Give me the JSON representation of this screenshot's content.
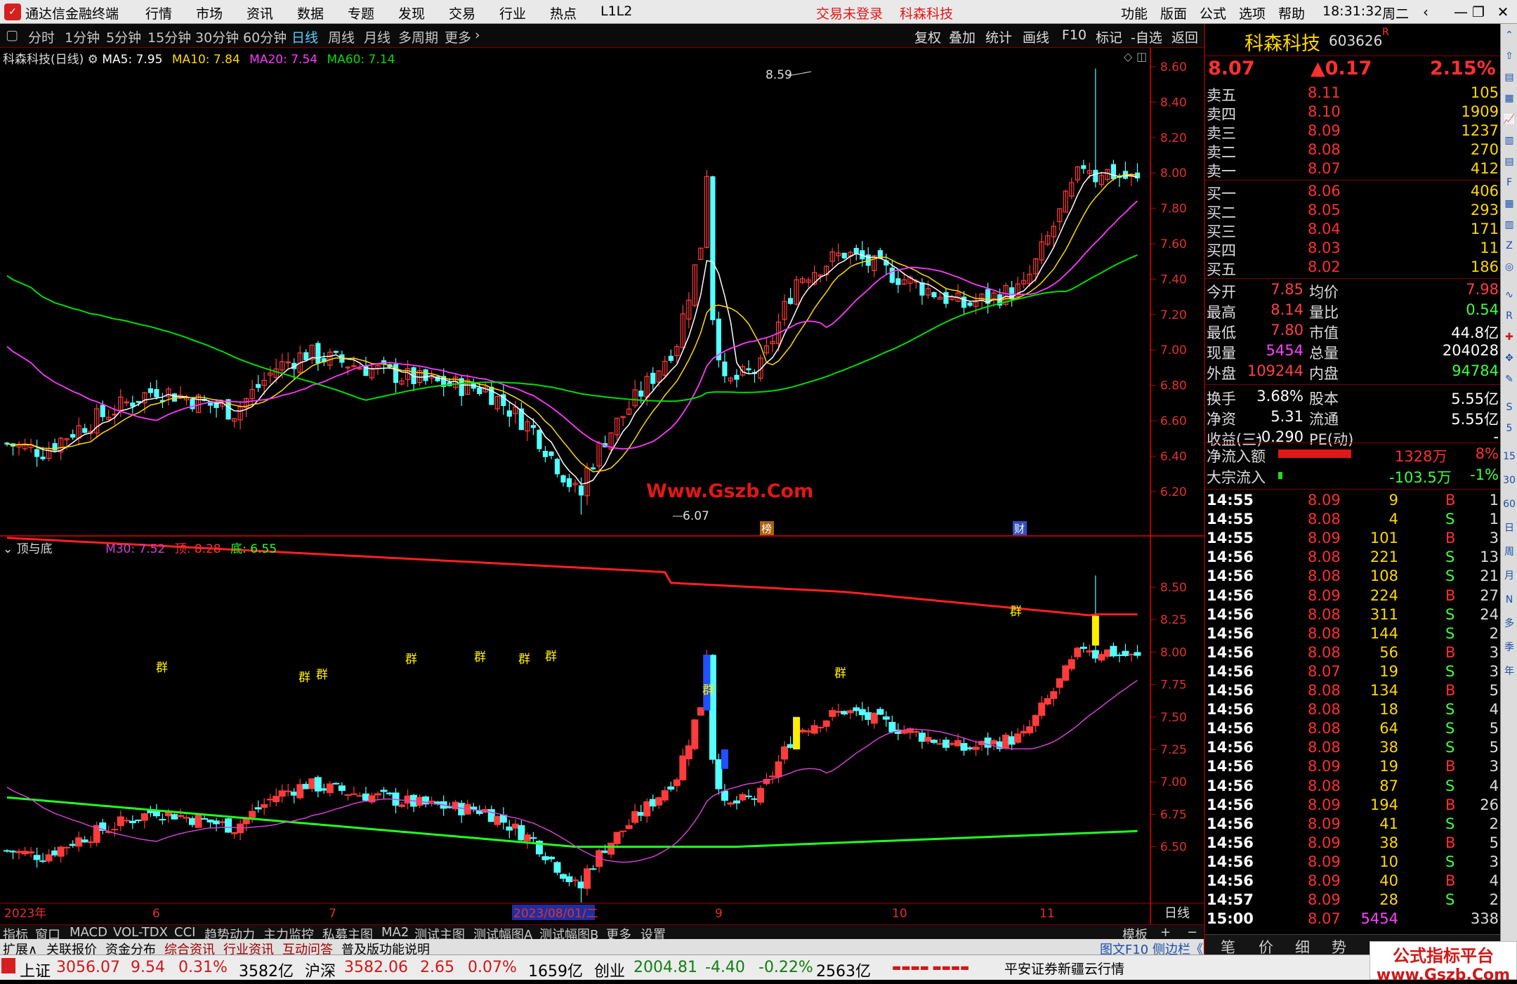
{
  "titlebar": {
    "app_name": "通达信金融终端",
    "menus": [
      "行情",
      "市场",
      "资讯",
      "数据",
      "专题",
      "发现",
      "交易",
      "行业",
      "热点",
      "L1L2"
    ],
    "login_status": "交易未登录",
    "stock_name": "科森科技",
    "right_menus": [
      "功能",
      "版面",
      "公式",
      "选项",
      "帮助"
    ],
    "clock": "18:31:32",
    "weekday": "周二"
  },
  "toolbar": {
    "periods": [
      "分时",
      "1分钟",
      "5分钟",
      "15分钟",
      "30分钟",
      "60分钟",
      "日线",
      "周线",
      "月线",
      "多周期",
      "更多"
    ],
    "active_period": "日线",
    "right_tools": [
      "复权",
      "叠加",
      "统计",
      "画线",
      "F10",
      "标记",
      "-自选",
      "返回"
    ]
  },
  "main_legend": {
    "title": "科森科技(日线)",
    "ma5": "MA5: 7.95",
    "ma10": "MA10: 7.84",
    "ma20": "MA20: 7.54",
    "ma60": "MA60: 7.14"
  },
  "sub_legend": {
    "title": "顶与底",
    "m30": "M30: 7.52",
    "top": "顶: 8.28",
    "bottom": "底: 6.55"
  },
  "annotations": {
    "high_label": "8.59",
    "low_label": "6.07",
    "watermark": "Www.Gszb.Com",
    "badge_bang": "榜",
    "badge_cai": "财",
    "qun_mark": "群"
  },
  "colors": {
    "up": "#ff3b3b",
    "down": "#54ffff",
    "ma5": "#ffffff",
    "ma10": "#ffd800",
    "ma20": "#ff38ff",
    "ma60": "#00dd00",
    "top_line": "#ff2020",
    "bottom_line": "#22ff22",
    "m30": "#d040d0",
    "axis": "#b00000"
  },
  "chart_data": {
    "type": "candlestick",
    "main_y_ticks": [
      "8.60",
      "8.40",
      "8.20",
      "8.00",
      "7.80",
      "7.60",
      "7.40",
      "7.20",
      "7.00",
      "6.80",
      "6.60",
      "6.40",
      "6.20"
    ],
    "sub_y_ticks": [
      "8.50",
      "8.25",
      "8.00",
      "7.75",
      "7.50",
      "7.25",
      "7.00",
      "6.75",
      "6.50"
    ],
    "x_labels": [
      "2023年",
      "6",
      "7",
      "2023/08/01/二",
      "9",
      "10",
      "11"
    ],
    "period_label": "日线",
    "series_names": [
      "MA5",
      "MA10",
      "MA20",
      "MA60",
      "M30",
      "顶",
      "底"
    ]
  },
  "quote": {
    "name": "科森科技",
    "code": "603626",
    "flag": "R",
    "price": "8.07",
    "change": "▲0.17",
    "pct": "2.15%",
    "asks": [
      {
        "label": "卖五",
        "price": "8.11",
        "vol": "105"
      },
      {
        "label": "卖四",
        "price": "8.10",
        "vol": "1909"
      },
      {
        "label": "卖三",
        "price": "8.09",
        "vol": "1237"
      },
      {
        "label": "卖二",
        "price": "8.08",
        "vol": "270"
      },
      {
        "label": "卖一",
        "price": "8.07",
        "vol": "412"
      }
    ],
    "bids": [
      {
        "label": "买一",
        "price": "8.06",
        "vol": "406"
      },
      {
        "label": "买二",
        "price": "8.05",
        "vol": "293"
      },
      {
        "label": "买三",
        "price": "8.04",
        "vol": "171"
      },
      {
        "label": "买四",
        "price": "8.03",
        "vol": "11"
      },
      {
        "label": "买五",
        "price": "8.02",
        "vol": "186"
      }
    ],
    "stats": [
      {
        "l1": "今开",
        "v1": "7.85",
        "l2": "均价",
        "v2": "7.98",
        "c1": "#ff4040",
        "c2": "#ff4040"
      },
      {
        "l1": "最高",
        "v1": "8.14",
        "l2": "量比",
        "v2": "0.54",
        "c1": "#ff4040",
        "c2": "#40ff40"
      },
      {
        "l1": "最低",
        "v1": "7.80",
        "l2": "市值",
        "v2": "44.8亿",
        "c1": "#ff4040",
        "c2": "#ffffff"
      },
      {
        "l1": "现量",
        "v1": "5454",
        "l2": "总量",
        "v2": "204028",
        "c1": "#ff40ff",
        "c2": "#ffffff"
      },
      {
        "l1": "外盘",
        "v1": "109244",
        "l2": "内盘",
        "v2": "94784",
        "c1": "#ff4040",
        "c2": "#40ff40"
      }
    ],
    "stats2": [
      {
        "l1": "换手",
        "v1": "3.68%",
        "l2": "股本",
        "v2": "5.55亿"
      },
      {
        "l1": "净资",
        "v1": "5.31",
        "l2": "流通",
        "v2": "5.55亿"
      },
      {
        "l1": "收益(三)",
        "v1": "-0.290",
        "l2": "PE(动)",
        "v2": "-"
      }
    ],
    "flows": [
      {
        "label": "净流入额",
        "value": "1328万",
        "pct": "8%"
      },
      {
        "label": "大宗流入",
        "value": "-103.5万",
        "pct": "-1%"
      }
    ],
    "ticks": [
      {
        "t": "14:55",
        "p": "8.09",
        "v": "9",
        "bs": "B",
        "n": "1"
      },
      {
        "t": "14:55",
        "p": "8.08",
        "v": "4",
        "bs": "S",
        "n": "1"
      },
      {
        "t": "14:55",
        "p": "8.09",
        "v": "101",
        "bs": "B",
        "n": "3"
      },
      {
        "t": "14:56",
        "p": "8.08",
        "v": "221",
        "bs": "S",
        "n": "13"
      },
      {
        "t": "14:56",
        "p": "8.08",
        "v": "108",
        "bs": "S",
        "n": "21"
      },
      {
        "t": "14:56",
        "p": "8.09",
        "v": "224",
        "bs": "B",
        "n": "27"
      },
      {
        "t": "14:56",
        "p": "8.08",
        "v": "311",
        "bs": "S",
        "n": "24"
      },
      {
        "t": "14:56",
        "p": "8.08",
        "v": "144",
        "bs": "S",
        "n": "2"
      },
      {
        "t": "14:56",
        "p": "8.08",
        "v": "56",
        "bs": "B",
        "n": "3"
      },
      {
        "t": "14:56",
        "p": "8.07",
        "v": "19",
        "bs": "S",
        "n": "3"
      },
      {
        "t": "14:56",
        "p": "8.08",
        "v": "134",
        "bs": "B",
        "n": "5"
      },
      {
        "t": "14:56",
        "p": "8.08",
        "v": "18",
        "bs": "S",
        "n": "4"
      },
      {
        "t": "14:56",
        "p": "8.08",
        "v": "64",
        "bs": "S",
        "n": "5"
      },
      {
        "t": "14:56",
        "p": "8.08",
        "v": "38",
        "bs": "S",
        "n": "5"
      },
      {
        "t": "14:56",
        "p": "8.09",
        "v": "19",
        "bs": "B",
        "n": "3"
      },
      {
        "t": "14:56",
        "p": "8.08",
        "v": "87",
        "bs": "S",
        "n": "4"
      },
      {
        "t": "14:56",
        "p": "8.09",
        "v": "194",
        "bs": "B",
        "n": "26"
      },
      {
        "t": "14:56",
        "p": "8.09",
        "v": "41",
        "bs": "S",
        "n": "2"
      },
      {
        "t": "14:56",
        "p": "8.09",
        "v": "38",
        "bs": "B",
        "n": "5"
      },
      {
        "t": "14:56",
        "p": "8.09",
        "v": "10",
        "bs": "S",
        "n": "3"
      },
      {
        "t": "14:56",
        "p": "8.09",
        "v": "40",
        "bs": "B",
        "n": "4"
      },
      {
        "t": "14:57",
        "p": "8.09",
        "v": "28",
        "bs": "S",
        "n": "2"
      },
      {
        "t": "15:00",
        "p": "8.07",
        "v": "5454",
        "bs": "",
        "n": "338"
      }
    ],
    "bottom_tabs": [
      "笔",
      "价",
      "细",
      "势"
    ]
  },
  "bottom_tabs": [
    "指标",
    "窗口",
    "MACD",
    "VOL-TDX",
    "CCI",
    "趋势动力",
    "主力监控",
    "私募主图",
    "MA2",
    "测试主图",
    "测试幅图A",
    "测试幅图B",
    "更多",
    "设置"
  ],
  "template_btn": "模板",
  "bottom_tabs2": [
    "扩展∧",
    "关联报价",
    "资金分布",
    "综合资讯",
    "行业资讯",
    "互动问答",
    "普及版功能说明"
  ],
  "bottom_right2": "图文F10  侧边栏《",
  "status": {
    "sh_label": "上证",
    "sh_val": "3056.07",
    "sh_chg": "9.54",
    "sh_pct": "0.31%",
    "sh_amt": "3582亿",
    "hs_label": "沪深",
    "hs_val": "3582.06",
    "hs_chg": "2.65",
    "hs_pct": "0.07%",
    "hs_amt": "1659亿",
    "cy_label": "创业",
    "cy_val": "2004.81",
    "cy_chg": "-4.40",
    "cy_pct": "-0.22%",
    "cy_amt": "2563亿",
    "broker": "平安证券新疆云行情"
  },
  "watermark2": {
    "line1": "公式指标平台",
    "line2": "www.Gszb.Com"
  }
}
